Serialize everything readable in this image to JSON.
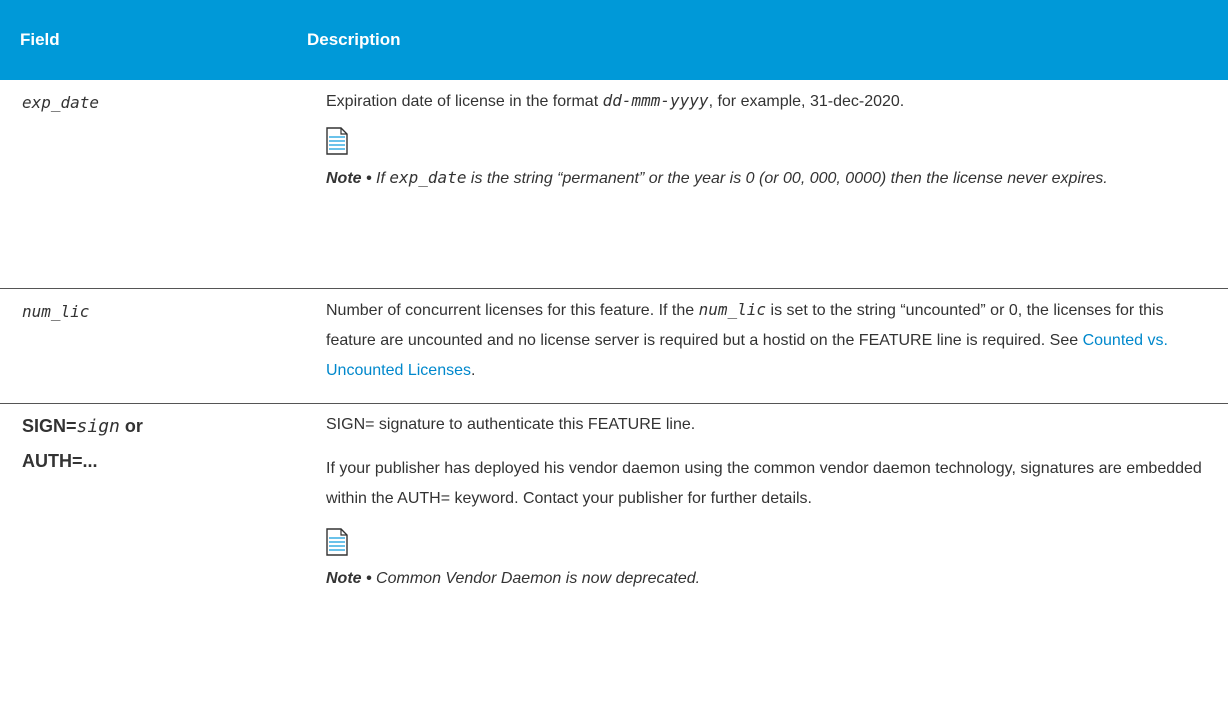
{
  "header": {
    "field": "Field",
    "description": "Description"
  },
  "rows": {
    "exp_date": {
      "field": "exp_date",
      "desc_pre": "Expiration date of license in the format ",
      "desc_format": "dd-mmm-yyyy",
      "desc_post": ", for example, 31-dec-2020.",
      "note_label": "Note •",
      "note_pre": " If ",
      "note_mono": "exp_date",
      "note_post": " is the string “permanent” or the year is 0 (or 00, 000, 0000) then the license never expires."
    },
    "num_lic": {
      "field": "num_lic",
      "desc_pre": "Number of concurrent licenses for this feature. If the ",
      "desc_mono": "num_lic",
      "desc_post": " is set to the string “uncounted” or 0, the licenses for this feature are uncounted and no license server is required but a hostid on the FEATURE line is required. See ",
      "link": "Counted vs. Uncounted Licenses",
      "desc_end": "."
    },
    "sign": {
      "field_sign": "SIGN=",
      "field_sign_italic": "sign",
      "field_or": " or",
      "field_auth": "AUTH=...",
      "para1": "SIGN= signature to authenticate this FEATURE line.",
      "para2": "If your publisher has deployed his vendor daemon using the common vendor daemon technology, signatures are embedded within the AUTH= keyword. Contact your publisher for further details.",
      "note_label": "Note •",
      "note_text": " Common Vendor Daemon is now deprecated."
    }
  },
  "icons": {
    "note": "note-document-icon"
  },
  "colors": {
    "header_bg": "#0099d8",
    "link": "#0088cc",
    "icon": "#2aa8e0"
  }
}
